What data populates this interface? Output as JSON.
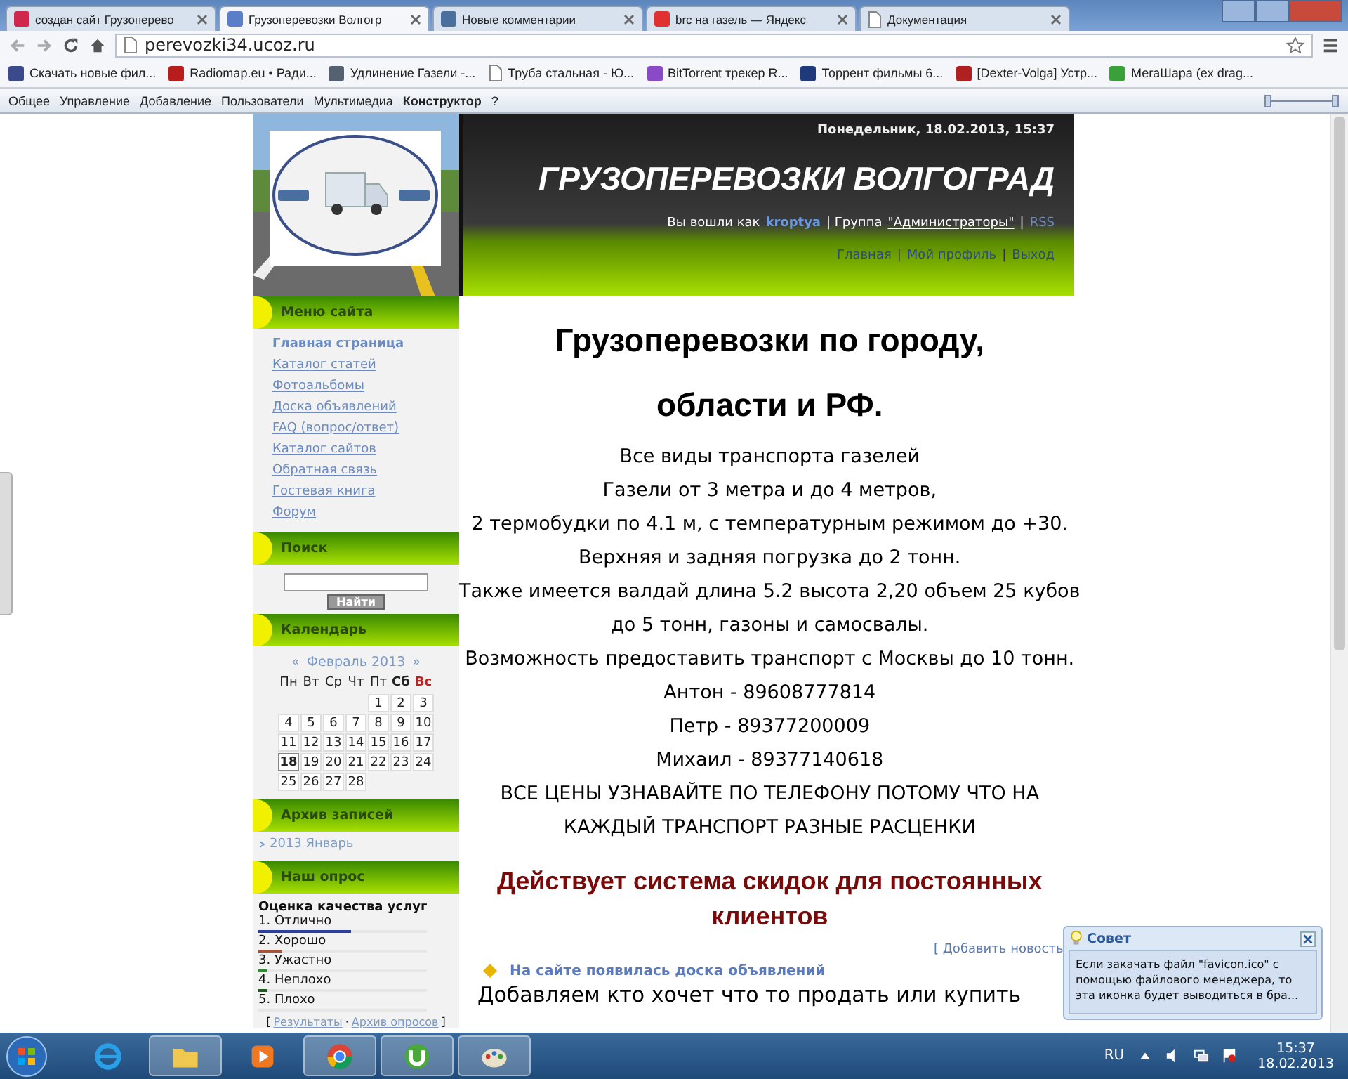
{
  "browser": {
    "tabs": [
      {
        "title": "создан сайт Грузоперево",
        "selected": false,
        "kind": "tile",
        "color": "#d0284c"
      },
      {
        "title": "Грузоперевозки Волгогр",
        "selected": true,
        "kind": "tile",
        "color": "#5a7fc8"
      },
      {
        "title": "Новые комментарии",
        "selected": false,
        "kind": "tile",
        "color": "#4a6f9c"
      },
      {
        "title": "brc на газель — Яндекс",
        "selected": false,
        "kind": "tile",
        "color": "#e03030"
      },
      {
        "title": "Документация",
        "selected": false,
        "kind": "page"
      }
    ],
    "address": "perevozki34.ucoz.ru",
    "bookmarks": [
      {
        "title": "Скачать новые фил...",
        "kind": "tile",
        "color": "#3a4a8a"
      },
      {
        "title": "Radiomap.eu • Ради...",
        "kind": "tile",
        "color": "#b81c1c"
      },
      {
        "title": "Удлинение Газели -...",
        "kind": "tile",
        "color": "#556070"
      },
      {
        "title": "Труба стальная - Ю...",
        "kind": "page"
      },
      {
        "title": "BitTorrent трекер R...",
        "kind": "tile",
        "color": "#8a4ac8"
      },
      {
        "title": "Торрент фильмы 6...",
        "kind": "tile",
        "color": "#1e3a7a"
      },
      {
        "title": "[Dexter-Volga] Устр...",
        "kind": "tile",
        "color": "#b02020"
      },
      {
        "title": "МегаШара (ex drag...",
        "kind": "tile",
        "color": "#3aa03a"
      }
    ]
  },
  "admin_bar": {
    "items": [
      {
        "label": "Общее",
        "active": false
      },
      {
        "label": "Управление",
        "active": false
      },
      {
        "label": "Добавление",
        "active": false
      },
      {
        "label": "Пользователи",
        "active": false
      },
      {
        "label": "Мультимедиа",
        "active": false
      },
      {
        "label": "Конструктор",
        "active": true
      },
      {
        "label": "?",
        "active": false
      }
    ]
  },
  "header": {
    "date": "Понедельник, 18.02.2013, 15:37",
    "title": "ГРУЗОПЕРЕВОЗКИ ВОЛГОГРАД",
    "login_text": "Вы вошли как",
    "user": "kroptya",
    "group_text": "| Группа",
    "group": "\"Администраторы\"",
    "rss_sep": "|",
    "rss": "RSS",
    "nav": [
      "Главная",
      "Мой профиль",
      "Выход"
    ],
    "nav_sep": "|"
  },
  "sidebar": {
    "menu": {
      "title": "Меню сайта",
      "items": [
        {
          "label": "Главная страница",
          "selected": true
        },
        {
          "label": "Каталог статей",
          "selected": false
        },
        {
          "label": "Фотоальбомы",
          "selected": false
        },
        {
          "label": "Доска объявлений",
          "selected": false
        },
        {
          "label": "FAQ (вопрос/ответ)",
          "selected": false
        },
        {
          "label": "Каталог сайтов",
          "selected": false
        },
        {
          "label": "Обратная связь",
          "selected": false
        },
        {
          "label": "Гостевая книга",
          "selected": false
        },
        {
          "label": "Форум",
          "selected": false
        }
      ]
    },
    "search": {
      "title": "Поиск",
      "button": "Найти"
    },
    "calendar": {
      "title": "Календарь",
      "prev": "«",
      "month": "Февраль 2013",
      "next": "»",
      "weekdays": [
        {
          "label": "Пн",
          "kind": "weekday"
        },
        {
          "label": "Вт",
          "kind": "weekday"
        },
        {
          "label": "Ср",
          "kind": "weekday"
        },
        {
          "label": "Чт",
          "kind": "weekday"
        },
        {
          "label": "Пт",
          "kind": "weekday"
        },
        {
          "label": "Сб",
          "kind": "saturday"
        },
        {
          "label": "Вс",
          "kind": "sunday"
        }
      ],
      "weeks": [
        [
          {
            "label": "1",
            "today": false
          },
          {
            "label": "2",
            "today": false
          },
          {
            "label": "3",
            "today": false
          }
        ],
        [
          {
            "label": "4",
            "today": false
          },
          {
            "label": "5",
            "today": false
          },
          {
            "label": "6",
            "today": false
          },
          {
            "label": "7",
            "today": false
          },
          {
            "label": "8",
            "today": false
          },
          {
            "label": "9",
            "today": false
          },
          {
            "label": "10",
            "today": false
          }
        ],
        [
          {
            "label": "11",
            "today": false
          },
          {
            "label": "12",
            "today": false
          },
          {
            "label": "13",
            "today": false
          },
          {
            "label": "14",
            "today": false
          },
          {
            "label": "15",
            "today": false
          },
          {
            "label": "16",
            "today": false
          },
          {
            "label": "17",
            "today": false
          }
        ],
        [
          {
            "label": "18",
            "today": true
          },
          {
            "label": "19",
            "today": false
          },
          {
            "label": "20",
            "today": false
          },
          {
            "label": "21",
            "today": false
          },
          {
            "label": "22",
            "today": false
          },
          {
            "label": "23",
            "today": false
          },
          {
            "label": "24",
            "today": false
          }
        ],
        [
          {
            "label": "25",
            "today": false
          },
          {
            "label": "26",
            "today": false
          },
          {
            "label": "27",
            "today": false
          },
          {
            "label": "28",
            "today": false
          }
        ]
      ]
    },
    "archive": {
      "title": "Архив записей",
      "items": [
        "2013 Январь"
      ]
    },
    "poll": {
      "title": "Наш опрос",
      "question": "Оценка качества услуг",
      "options": [
        {
          "label": "1. Отлично",
          "level": 0.55,
          "color": "#2a3fa0"
        },
        {
          "label": "2. Хорошо",
          "level": 0.14,
          "color": "#a0553d"
        },
        {
          "label": "3. Ужастно",
          "level": 0.05,
          "color": "#2e8b2e"
        },
        {
          "label": "4. Неплохо",
          "level": 0.05,
          "color": "#1d5a1d"
        },
        {
          "label": "5. Плохо",
          "level": 0
        }
      ],
      "links_open": "[",
      "links": [
        "Результаты",
        "Архив опросов"
      ],
      "links_sep": "·",
      "links_close": "]"
    }
  },
  "content": {
    "heading": "Грузоперевозки по городу, области и РФ.",
    "lines": [
      "Все виды транспорта газелей",
      "Газели от 3 метра и до 4 метров,",
      "2 термобудки по 4.1 м, с температурным режимом до +30.",
      "Верхняя и задняя погрузка до 2 тонн.",
      "Также имеется валдай длина 5.2 высота 2,20 объем 25 кубов",
      "до 5 тонн, газоны и самосвалы.",
      "Возможность предоставить транспорт с Москвы до 10 тонн."
    ],
    "contacts": [
      "Антон - 89608777814",
      "Петр - 89377200009",
      "Михаил - 89377140618"
    ],
    "notice": [
      "ВСЕ ЦЕНЫ УЗНАВАЙТЕ ПО ТЕЛЕФОНУ ПОТОМУ ЧТО НА",
      "КАЖДЫЙ ТРАНСПОРТ РАЗНЫЕ РАСЦЕНКИ"
    ],
    "discount": "Действует система скидок для постоянных клиентов",
    "add_news": "[ Добавить новость",
    "news": [
      {
        "title": "На сайте появилась доска объявлений",
        "text": "Добавляем кто хочет что то продать или купить"
      }
    ]
  },
  "tip": {
    "title": "Совет",
    "text": "Если закачать файл \"favicon.ico\" с помощью файлового менеджера, то эта иконка будет выводиться в бра..."
  },
  "taskbar": {
    "language": "RU",
    "time": "15:37",
    "date": "18.02.2013"
  }
}
